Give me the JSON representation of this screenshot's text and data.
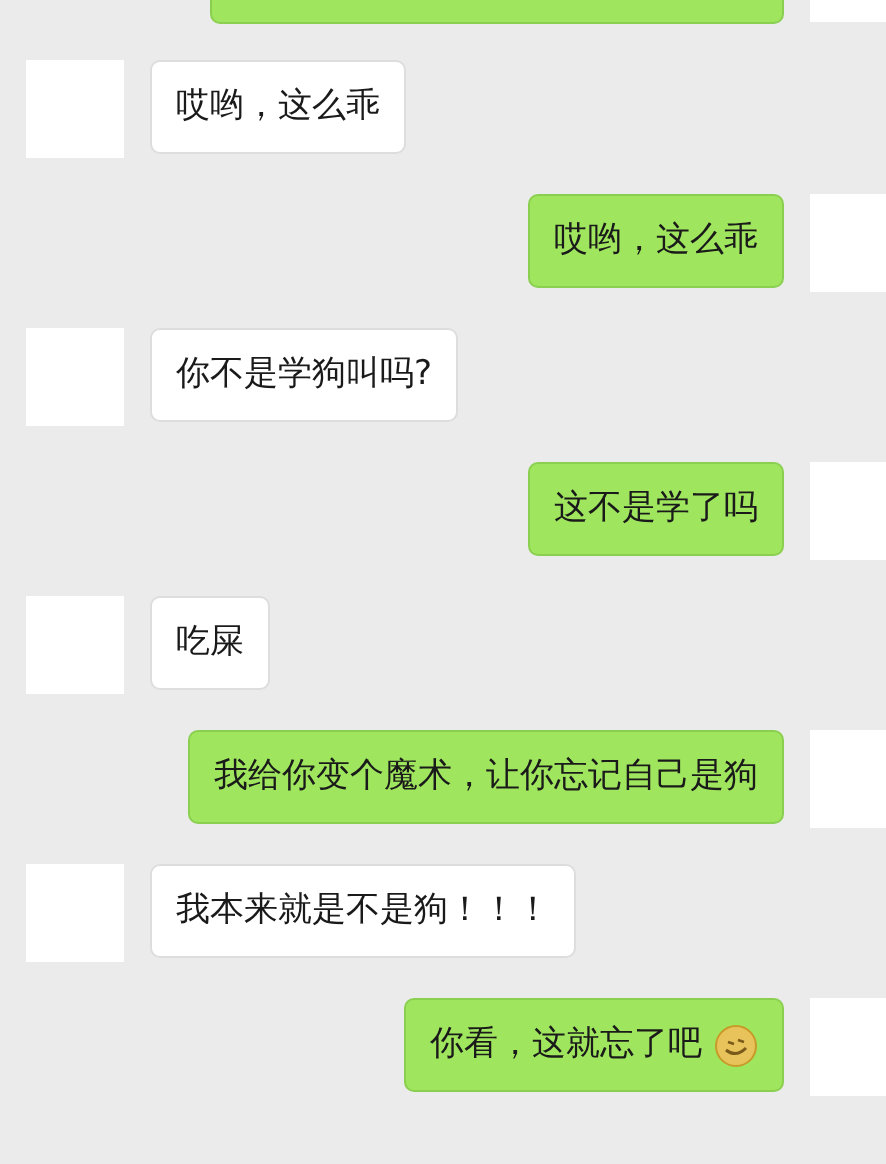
{
  "messages": [
    {
      "kind": "sent"
    },
    {
      "kind": "received",
      "text": "哎哟，这么乖"
    },
    {
      "kind": "sent",
      "text": "哎哟，这么乖"
    },
    {
      "kind": "received",
      "text": "你不是学狗叫吗?"
    },
    {
      "kind": "sent",
      "text": "这不是学了吗"
    },
    {
      "kind": "received",
      "text": "吃屎"
    },
    {
      "kind": "sent",
      "text": "我给你变个魔术，让你忘记自己是狗"
    },
    {
      "kind": "received",
      "text": "我本来就是不是狗！！！"
    },
    {
      "kind": "sent",
      "text": "你看，这就忘了吧",
      "emoji": true
    }
  ]
}
